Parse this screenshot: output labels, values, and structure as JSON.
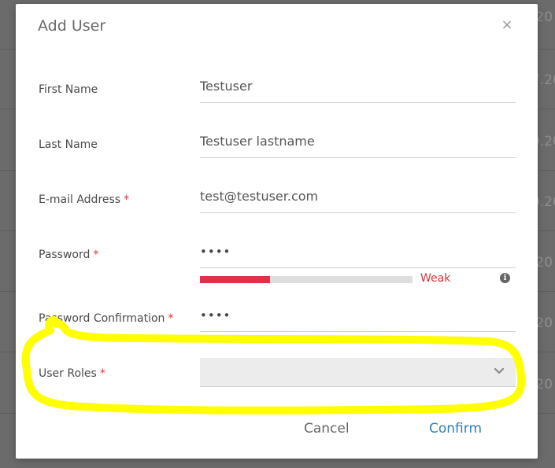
{
  "background": {
    "row_fragments": [
      ".20",
      "7.20",
      "9.20",
      "0.20",
      ".20",
      ".20",
      ".20"
    ]
  },
  "modal": {
    "title": "Add User",
    "close_symbol": "×",
    "fields": {
      "first_name": {
        "label": "First Name",
        "value": "Testuser",
        "required": false
      },
      "last_name": {
        "label": "Last Name",
        "value": "Testuser lastname",
        "required": false
      },
      "email": {
        "label": "E-mail Address",
        "value": "test@testuser.com",
        "required": true
      },
      "password": {
        "label": "Password",
        "value": "••••",
        "required": true
      },
      "password_confirmation": {
        "label": "Password Confirmation",
        "value": "••••",
        "required": true
      },
      "user_roles": {
        "label": "User Roles",
        "value": "",
        "required": true
      }
    },
    "required_marker": "*",
    "password_strength": {
      "label": "Weak",
      "level": 0.33,
      "color": "#e0314b"
    },
    "info_icon": "info-icon",
    "buttons": {
      "cancel": "Cancel",
      "confirm": "Confirm"
    }
  },
  "annotation": {
    "color": "#ffff00",
    "target": "User Roles"
  }
}
